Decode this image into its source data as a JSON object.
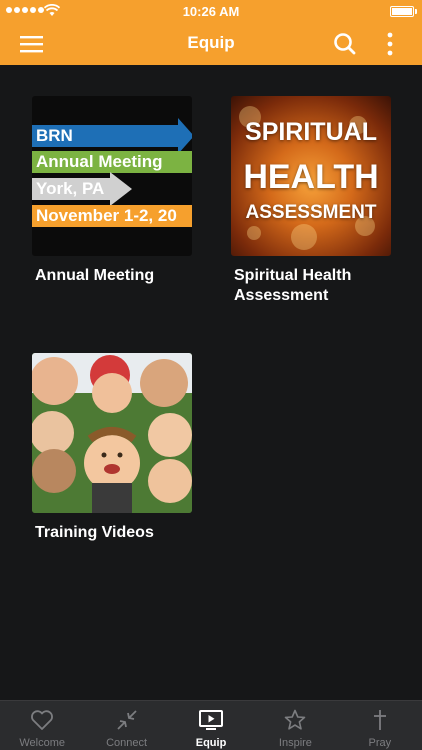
{
  "status_bar": {
    "time": "10:26 AM"
  },
  "nav": {
    "title": "Equip"
  },
  "tiles": [
    {
      "label": "Annual Meeting",
      "thumb_lines": [
        "BRN",
        "Annual Meeting",
        "York, PA",
        "November 1-2, 20"
      ]
    },
    {
      "label": "Spiritual Health Assessment",
      "thumb_lines": [
        "SPIRITUAL",
        "HEALTH",
        "ASSESSMENT"
      ]
    },
    {
      "label": "Training Videos"
    }
  ],
  "tabs": [
    {
      "label": "Welcome",
      "icon": "heart-icon"
    },
    {
      "label": "Connect",
      "icon": "shrink-arrows-icon"
    },
    {
      "label": "Equip",
      "icon": "play-screen-icon",
      "active": true
    },
    {
      "label": "Inspire",
      "icon": "star-icon"
    },
    {
      "label": "Pray",
      "icon": "cross-icon"
    }
  ],
  "colors": {
    "accent": "#f6a02d",
    "background": "#161718",
    "tabbar": "#2b2c2e"
  }
}
